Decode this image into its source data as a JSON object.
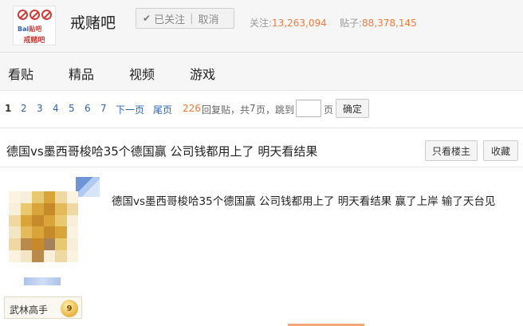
{
  "header": {
    "logo_brand_left": "Bai",
    "logo_brand_right": "贴吧",
    "logo_name": "戒赌吧",
    "forum_name": "戒赌吧",
    "follow_label": "已关注",
    "unfollow_label": "取消",
    "follow_stat_label": "关注:",
    "follow_stat_value": "13,263,094",
    "post_stat_label": "贴子:",
    "post_stat_value": "88,378,145"
  },
  "tabs": [
    {
      "label": "看贴"
    },
    {
      "label": "精品"
    },
    {
      "label": "视频"
    },
    {
      "label": "游戏"
    }
  ],
  "pager": {
    "pages": [
      "1",
      "2",
      "3",
      "4",
      "5",
      "6",
      "7"
    ],
    "next_label": "下一页",
    "last_label": "尾页",
    "reply_count": "226",
    "reply_suffix": "回复贴，共",
    "page_total": "7",
    "page_suffix": "页，跳到",
    "page_unit": "页",
    "go_label": "确定"
  },
  "thread": {
    "title": "德国vs墨西哥梭哈35个德国赢 公司钱都用上了 明天看结果",
    "only_op_label": "只看楼主",
    "favorite_label": "收藏"
  },
  "post": {
    "body": "德国vs墨西哥梭哈35个德国赢 公司钱都用上了 明天看结果 赢了上岸 输了天台见",
    "badge_label": "武林高手",
    "badge_level": "9"
  },
  "colors": {
    "accent_orange": "#f07a3a",
    "link_blue": "#2d64b3"
  }
}
